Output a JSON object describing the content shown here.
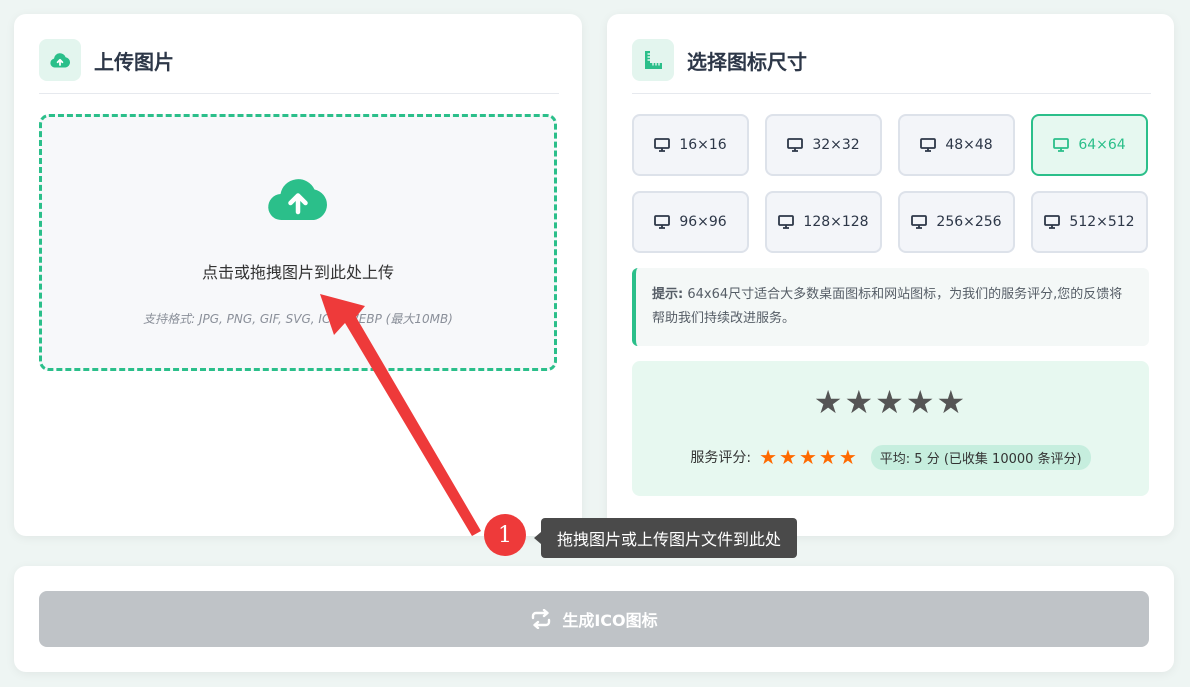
{
  "upload": {
    "title": "上传图片",
    "title_icon": "cloud-upload-icon",
    "dropzone_text": "点击或拖拽图片到此处上传",
    "formats_text": "支持格式: JPG, PNG, GIF, SVG, ICO, WEBP (最大10MB)"
  },
  "sizes": {
    "title": "选择图标尺寸",
    "title_icon": "ruler-icon",
    "options": [
      "16×16",
      "32×32",
      "48×48",
      "64×64",
      "96×96",
      "128×128",
      "256×256",
      "512×512"
    ],
    "selected": "64×64",
    "option_icon": "monitor-icon"
  },
  "tip": {
    "label": "提示:",
    "text": "64x64尺寸适合大多数桌面图标和网站图标，为我们的服务评分,您的反馈将帮助我们持续改进服务。"
  },
  "rating": {
    "big_stars": "★★★★★",
    "label": "服务评分:",
    "stars": 5,
    "average_text": "平均: 5 分 (已收集 10000 条评分)"
  },
  "action": {
    "generate_label": "生成ICO图标",
    "generate_icon": "refresh-icon"
  },
  "annotation": {
    "step_number": "1",
    "tooltip_text": "拖拽图片或上传图片文件到此处"
  },
  "colors": {
    "accent": "#2bbf8a",
    "star_orange": "#ff6a00",
    "annotation_red": "#ee3a3a",
    "disabled_button": "#bfc3c7"
  }
}
